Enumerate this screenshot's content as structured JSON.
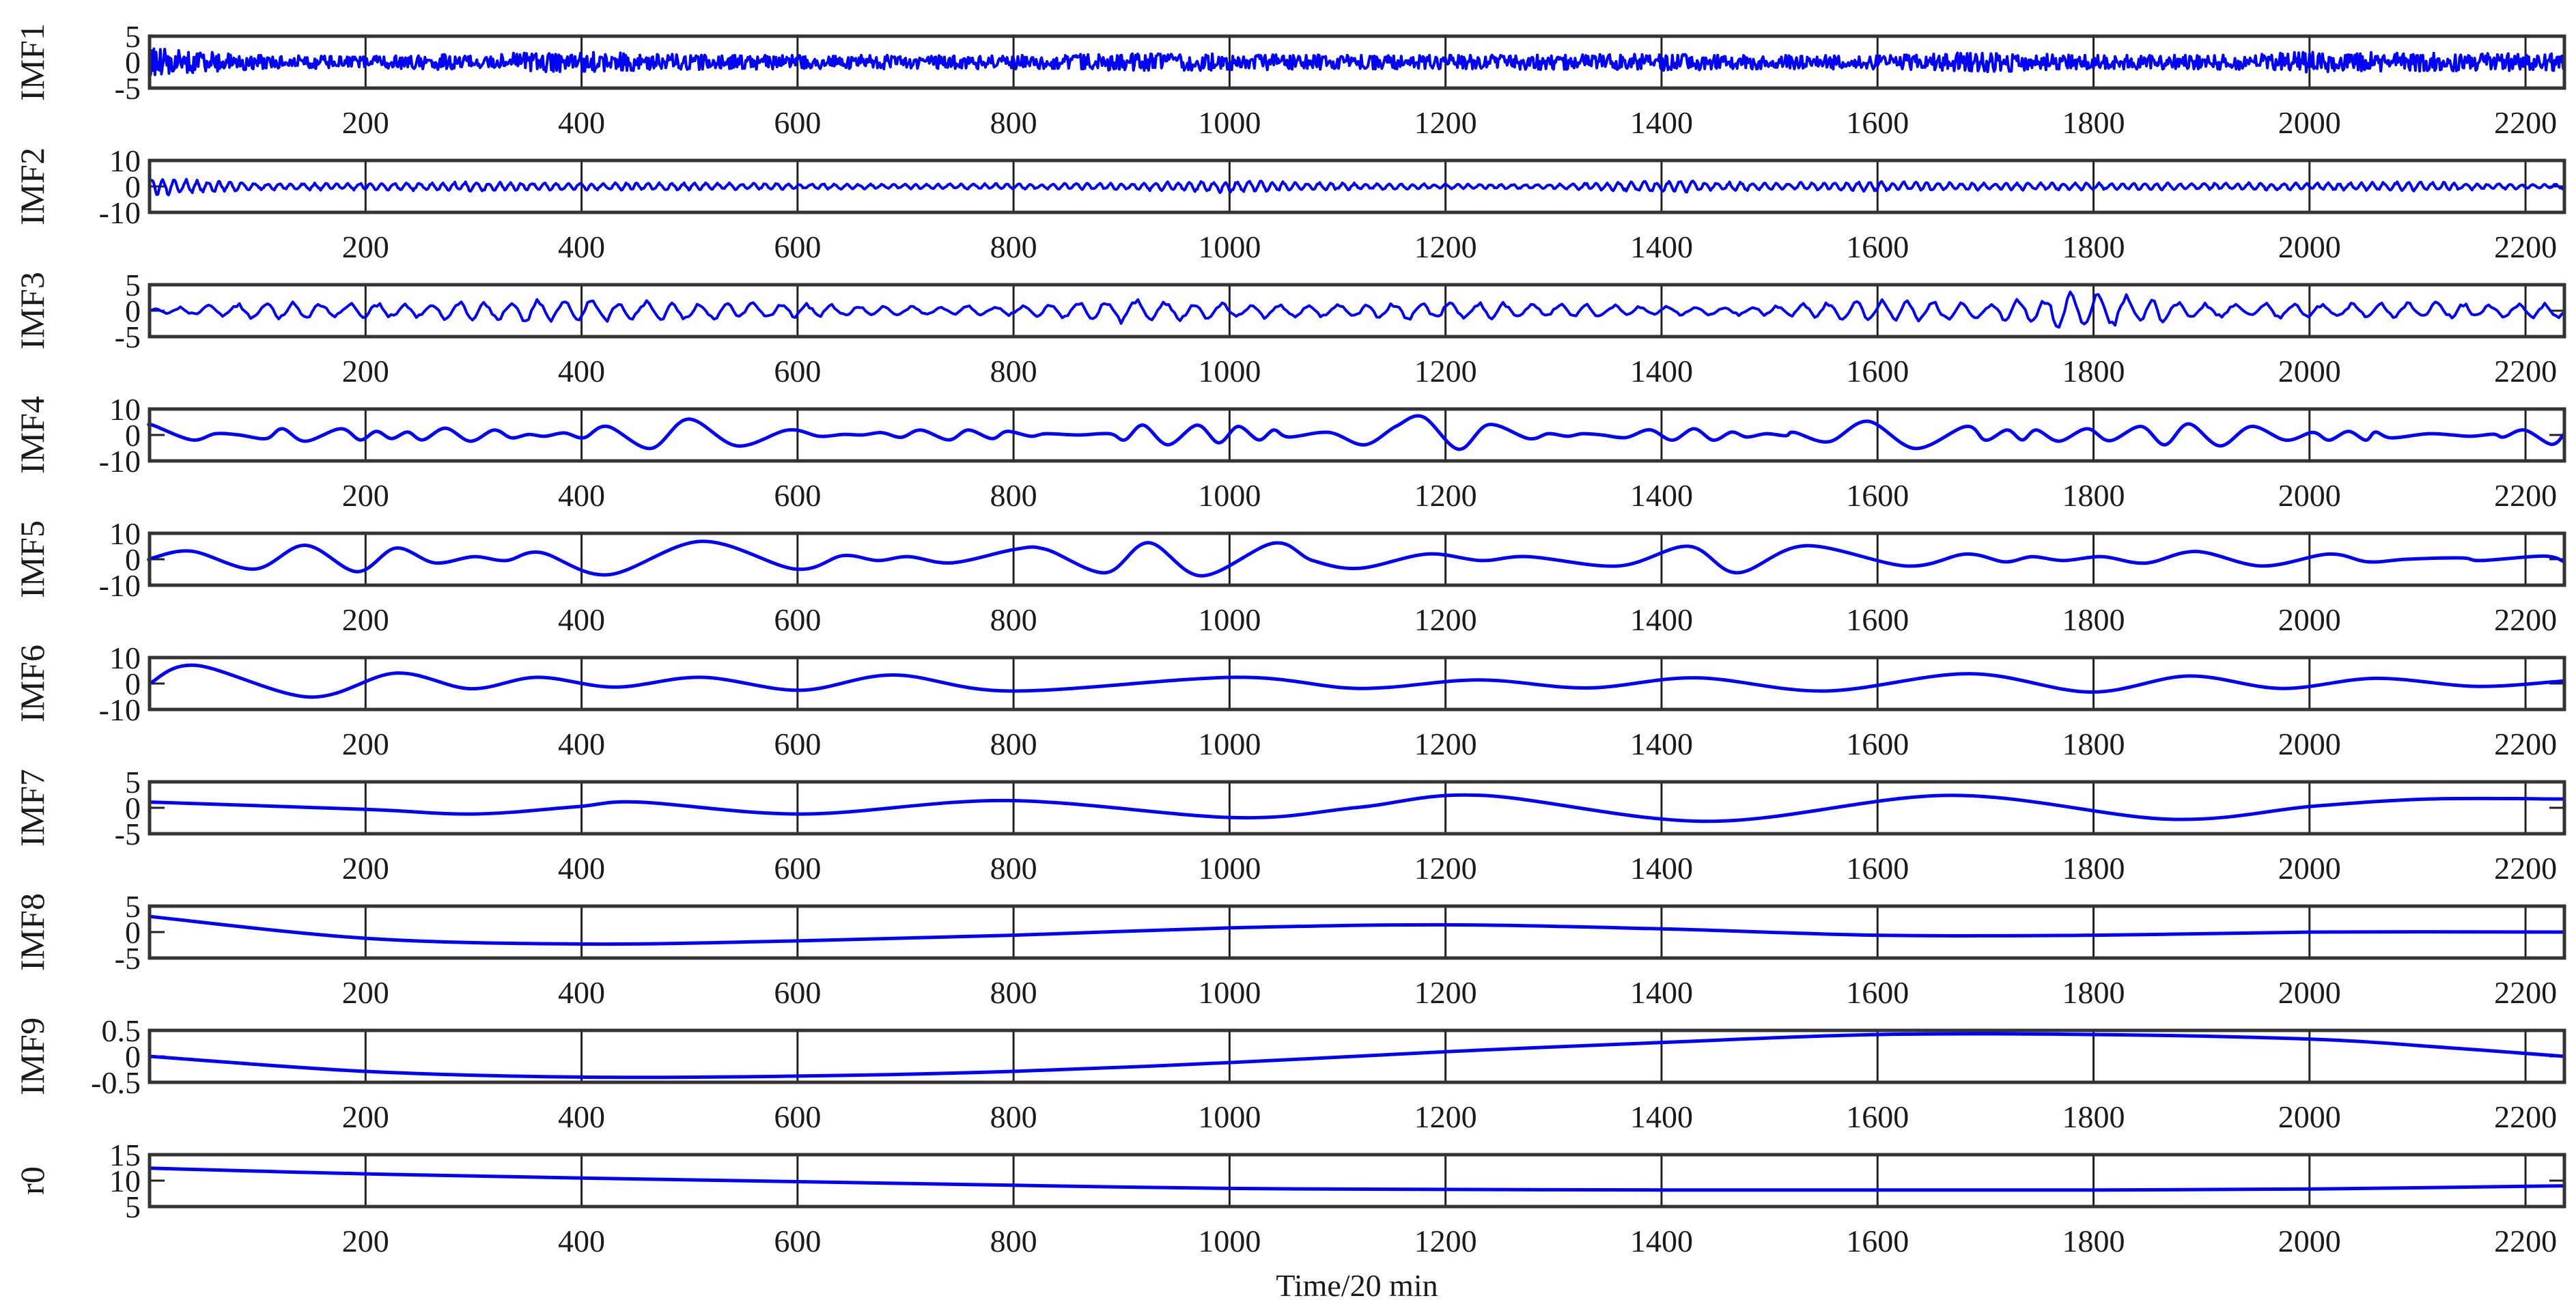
{
  "chart_data": {
    "type": "line",
    "title": "",
    "xlabel": "Time/20 min",
    "xlim": [
      0,
      2236
    ],
    "xticks": [
      200,
      400,
      600,
      800,
      1000,
      1200,
      1400,
      1600,
      1800,
      2000,
      2200
    ],
    "xtick_labels": [
      "200",
      "400",
      "600",
      "800",
      "1000",
      "1200",
      "1400",
      "1600",
      "1800",
      "2000",
      "2200"
    ],
    "grid": "vertical lines at x ticks",
    "line_color": "#0000ff",
    "panels": [
      {
        "name": "IMF1",
        "ylabel": "IMF1",
        "ylim": [
          -5,
          5
        ],
        "yticks": [
          5,
          0,
          -5
        ],
        "ytick_labels": [
          "5",
          "0",
          "-5"
        ],
        "mode": "oscillation",
        "period": 4,
        "envelope_step": 100,
        "envelope": [
          3,
          1.5,
          1.3,
          1.8,
          2.2,
          1.6,
          1.5,
          1.5,
          1.5,
          1.8,
          1.8,
          1.5,
          1.5,
          1.6,
          1.8,
          1.5,
          1.5,
          2.2,
          1.5,
          1.5,
          2.2,
          2,
          1.8
        ]
      },
      {
        "name": "IMF2",
        "ylabel": "IMF2",
        "ylim": [
          -10,
          10
        ],
        "yticks": [
          10,
          0,
          -10
        ],
        "ytick_labels": [
          "10",
          "0",
          "-10"
        ],
        "mode": "oscillation",
        "period": 11,
        "envelope_step": 100,
        "envelope": [
          4,
          1.5,
          1.5,
          2,
          1.5,
          1.5,
          1.2,
          1,
          1.2,
          1.5,
          2.5,
          1.5,
          1,
          1,
          2.5,
          1.5,
          2,
          1.5,
          1.5,
          1.5,
          1.5,
          2,
          1
        ]
      },
      {
        "name": "IMF3",
        "ylabel": "IMF3",
        "ylim": [
          -5,
          5
        ],
        "yticks": [
          5,
          0,
          -5
        ],
        "ytick_labels": [
          "5",
          "0",
          "-5"
        ],
        "mode": "oscillation",
        "period": 26,
        "envelope_step": 100,
        "envelope": [
          0.3,
          2,
          1.5,
          2,
          2.5,
          2,
          1.5,
          1,
          1,
          2.5,
          1.5,
          1.5,
          2,
          1.5,
          1,
          1,
          2.8,
          1.5,
          4.5,
          1.5,
          1.5,
          1.8,
          1.5
        ]
      },
      {
        "name": "IMF4",
        "ylabel": "IMF4",
        "ylim": [
          -10,
          10
        ],
        "yticks": [
          10,
          0,
          -10
        ],
        "ytick_labels": [
          "10",
          "0",
          "-10"
        ],
        "mode": "points",
        "points": [
          [
            0,
            3.5
          ],
          [
            3,
            3.8
          ],
          [
            39,
            -1.9
          ],
          [
            61,
            0.5
          ],
          [
            83,
            0
          ],
          [
            108,
            -1.4
          ],
          [
            123,
            2.4
          ],
          [
            144,
            -2.4
          ],
          [
            177,
            2.4
          ],
          [
            195,
            -1.9
          ],
          [
            210,
            1.4
          ],
          [
            224,
            -1.4
          ],
          [
            239,
            1.1
          ],
          [
            253,
            -1.9
          ],
          [
            274,
            2.6
          ],
          [
            297,
            -2.4
          ],
          [
            319,
            1.9
          ],
          [
            335,
            -1.1
          ],
          [
            351,
            0.2
          ],
          [
            366,
            -0.5
          ],
          [
            384,
            0.8
          ],
          [
            402,
            -1.1
          ],
          [
            424,
            3.3
          ],
          [
            464,
            -5.2
          ],
          [
            499,
            6.1
          ],
          [
            544,
            -4.2
          ],
          [
            591,
            1.9
          ],
          [
            620,
            -0.5
          ],
          [
            642,
            0.2
          ],
          [
            660,
            0
          ],
          [
            678,
            0.9
          ],
          [
            696,
            -0.9
          ],
          [
            714,
            1.9
          ],
          [
            740,
            -1.9
          ],
          [
            758,
            1.9
          ],
          [
            780,
            -1.4
          ],
          [
            794,
            1.4
          ],
          [
            816,
            -0.5
          ],
          [
            830,
            0.5
          ],
          [
            860,
            0
          ],
          [
            889,
            0.5
          ],
          [
            903,
            -1.9
          ],
          [
            920,
            3.8
          ],
          [
            943,
            -3.8
          ],
          [
            970,
            3.8
          ],
          [
            990,
            -3.0
          ],
          [
            1008,
            3.3
          ],
          [
            1027,
            -1.9
          ],
          [
            1041,
            1.9
          ],
          [
            1055,
            -0.8
          ],
          [
            1092,
            1.0
          ],
          [
            1125,
            -3.8
          ],
          [
            1154,
            3.3
          ],
          [
            1179,
            7
          ],
          [
            1212,
            -5.5
          ],
          [
            1240,
            4
          ],
          [
            1277,
            -1.4
          ],
          [
            1295,
            0.5
          ],
          [
            1313,
            -0.5
          ],
          [
            1327,
            0.5
          ],
          [
            1345,
            0
          ],
          [
            1367,
            -1
          ],
          [
            1389,
            2
          ],
          [
            1410,
            -2
          ],
          [
            1430,
            2.4
          ],
          [
            1448,
            -2
          ],
          [
            1465,
            1.1
          ],
          [
            1479,
            -0.8
          ],
          [
            1497,
            0.5
          ],
          [
            1515,
            -0.3
          ],
          [
            1523,
            1
          ],
          [
            1555,
            -2.6
          ],
          [
            1591,
            5.3
          ],
          [
            1635,
            -5.2
          ],
          [
            1682,
            3.3
          ],
          [
            1700,
            -2
          ],
          [
            1720,
            1.9
          ],
          [
            1734,
            -1.9
          ],
          [
            1747,
            1.9
          ],
          [
            1768,
            -2.4
          ],
          [
            1794,
            2.4
          ],
          [
            1815,
            -2.2
          ],
          [
            1844,
            3.3
          ],
          [
            1866,
            -3.8
          ],
          [
            1888,
            4.3
          ],
          [
            1917,
            -4.2
          ],
          [
            1946,
            3.3
          ],
          [
            1978,
            -2
          ],
          [
            2003,
            1.0
          ],
          [
            2018,
            -2
          ],
          [
            2036,
            1.4
          ],
          [
            2052,
            -2
          ],
          [
            2061,
            1.1
          ],
          [
            2076,
            -1.1
          ],
          [
            2112,
            0.5
          ],
          [
            2148,
            -0.5
          ],
          [
            2170,
            0.3
          ],
          [
            2180,
            -0.8
          ],
          [
            2199,
            1.9
          ],
          [
            2224,
            -3.6
          ],
          [
            2236,
            0.5
          ]
        ]
      },
      {
        "name": "IMF5",
        "ylabel": "IMF5",
        "ylim": [
          -10,
          10
        ],
        "yticks": [
          10,
          0,
          -10
        ],
        "ytick_labels": [
          "10",
          "0",
          "-10"
        ],
        "mode": "points",
        "points": [
          [
            0,
            -0.5
          ],
          [
            3,
            0.5
          ],
          [
            39,
            3.1
          ],
          [
            97,
            -3.8
          ],
          [
            144,
            5.4
          ],
          [
            192,
            -4.8
          ],
          [
            228,
            4.3
          ],
          [
            264,
            -1.4
          ],
          [
            300,
            1.0
          ],
          [
            330,
            -0.5
          ],
          [
            362,
            2.6
          ],
          [
            424,
            -6
          ],
          [
            511,
            6.9
          ],
          [
            598,
            -3.8
          ],
          [
            642,
            1.4
          ],
          [
            674,
            -0.5
          ],
          [
            703,
            1.0
          ],
          [
            743,
            -1.4
          ],
          [
            801,
            3.8
          ],
          [
            830,
            3.8
          ],
          [
            885,
            -5.2
          ],
          [
            925,
            6.4
          ],
          [
            974,
            -6.4
          ],
          [
            1041,
            6.2
          ],
          [
            1077,
            -0.5
          ],
          [
            1120,
            -3.5
          ],
          [
            1183,
            2
          ],
          [
            1233,
            -0.5
          ],
          [
            1277,
            1
          ],
          [
            1360,
            -2.6
          ],
          [
            1425,
            5
          ],
          [
            1470,
            -5.2
          ],
          [
            1533,
            5.2
          ],
          [
            1627,
            -2.6
          ],
          [
            1682,
            2
          ],
          [
            1718,
            -1
          ],
          [
            1743,
            1
          ],
          [
            1772,
            -0.5
          ],
          [
            1808,
            1
          ],
          [
            1848,
            -1.5
          ],
          [
            1895,
            3
          ],
          [
            1956,
            -2.6
          ],
          [
            2018,
            2
          ],
          [
            2054,
            -1
          ],
          [
            2090,
            0
          ],
          [
            2141,
            0.5
          ],
          [
            2159,
            -0.5
          ],
          [
            2217,
            1.2
          ],
          [
            2236,
            -1
          ]
        ]
      },
      {
        "name": "IMF6",
        "ylabel": "IMF6",
        "ylim": [
          -10,
          10
        ],
        "yticks": [
          10,
          0,
          -10
        ],
        "ytick_labels": [
          "10",
          "0",
          "-10"
        ],
        "mode": "points",
        "points": [
          [
            0,
            0
          ],
          [
            43,
            7
          ],
          [
            148,
            -5.2
          ],
          [
            228,
            4
          ],
          [
            297,
            -2
          ],
          [
            359,
            2.4
          ],
          [
            431,
            -1.4
          ],
          [
            511,
            2.4
          ],
          [
            602,
            -2.6
          ],
          [
            689,
            3.3
          ],
          [
            798,
            -2.9
          ],
          [
            1005,
            2.4
          ],
          [
            1120,
            -1.9
          ],
          [
            1230,
            1.4
          ],
          [
            1331,
            -1.7
          ],
          [
            1432,
            2.2
          ],
          [
            1551,
            -2.9
          ],
          [
            1685,
            3.8
          ],
          [
            1797,
            -3.3
          ],
          [
            1888,
            2.9
          ],
          [
            1974,
            -1.9
          ],
          [
            2061,
            2.0
          ],
          [
            2155,
            -1.1
          ],
          [
            2236,
            1.0
          ]
        ]
      },
      {
        "name": "IMF7",
        "ylabel": "IMF7",
        "ylim": [
          -5,
          5
        ],
        "yticks": [
          5,
          0,
          -5
        ],
        "ytick_labels": [
          "5",
          "0",
          "-5"
        ],
        "mode": "points",
        "points": [
          [
            0,
            1.1
          ],
          [
            200,
            -0.3
          ],
          [
            300,
            -1.2
          ],
          [
            395,
            0.2
          ],
          [
            453,
            1.1
          ],
          [
            605,
            -1.2
          ],
          [
            794,
            1.4
          ],
          [
            1005,
            -1.9
          ],
          [
            1120,
            0.1
          ],
          [
            1233,
            2.4
          ],
          [
            1443,
            -2.6
          ],
          [
            1667,
            2.4
          ],
          [
            1870,
            -2.2
          ],
          [
            2003,
            0.3
          ],
          [
            2112,
            1.7
          ],
          [
            2236,
            1.7
          ]
        ]
      },
      {
        "name": "IMF8",
        "ylabel": "IMF8",
        "ylim": [
          -5,
          5
        ],
        "yticks": [
          5,
          0,
          -5
        ],
        "ytick_labels": [
          "5",
          "0",
          "-5"
        ],
        "mode": "points",
        "points": [
          [
            0,
            3
          ],
          [
            200,
            -1.2
          ],
          [
            400,
            -2.3
          ],
          [
            600,
            -1.7
          ],
          [
            800,
            -0.6
          ],
          [
            1000,
            0.8
          ],
          [
            1200,
            1.4
          ],
          [
            1403,
            0.6
          ],
          [
            1599,
            -0.6
          ],
          [
            1801,
            -0.6
          ],
          [
            2003,
            0
          ],
          [
            2236,
            0
          ]
        ]
      },
      {
        "name": "IMF9",
        "ylabel": "IMF9",
        "ylim": [
          -0.5,
          0.5
        ],
        "yticks": [
          0.5,
          0,
          -0.5
        ],
        "ytick_labels": [
          "0.5",
          "0",
          "-0.5"
        ],
        "mode": "points",
        "points": [
          [
            0,
            0
          ],
          [
            200,
            -0.29
          ],
          [
            400,
            -0.4
          ],
          [
            600,
            -0.38
          ],
          [
            800,
            -0.29
          ],
          [
            1000,
            -0.12
          ],
          [
            1200,
            0.09
          ],
          [
            1403,
            0.27
          ],
          [
            1599,
            0.42
          ],
          [
            1801,
            0.42
          ],
          [
            2003,
            0.33
          ],
          [
            2126,
            0.17
          ],
          [
            2236,
            0
          ]
        ]
      },
      {
        "name": "r0",
        "ylabel": "r0",
        "ylim": [
          5,
          15
        ],
        "yticks": [
          15,
          10,
          5
        ],
        "ytick_labels": [
          "15",
          "10",
          "5"
        ],
        "mode": "points",
        "points": [
          [
            0,
            12.4
          ],
          [
            200,
            11.3
          ],
          [
            400,
            10.5
          ],
          [
            600,
            9.8
          ],
          [
            800,
            9.1
          ],
          [
            1000,
            8.5
          ],
          [
            1200,
            8.3
          ],
          [
            1403,
            8.2
          ],
          [
            1600,
            8.2
          ],
          [
            1801,
            8.2
          ],
          [
            2003,
            8.4
          ],
          [
            2236,
            9.0
          ]
        ]
      }
    ]
  }
}
